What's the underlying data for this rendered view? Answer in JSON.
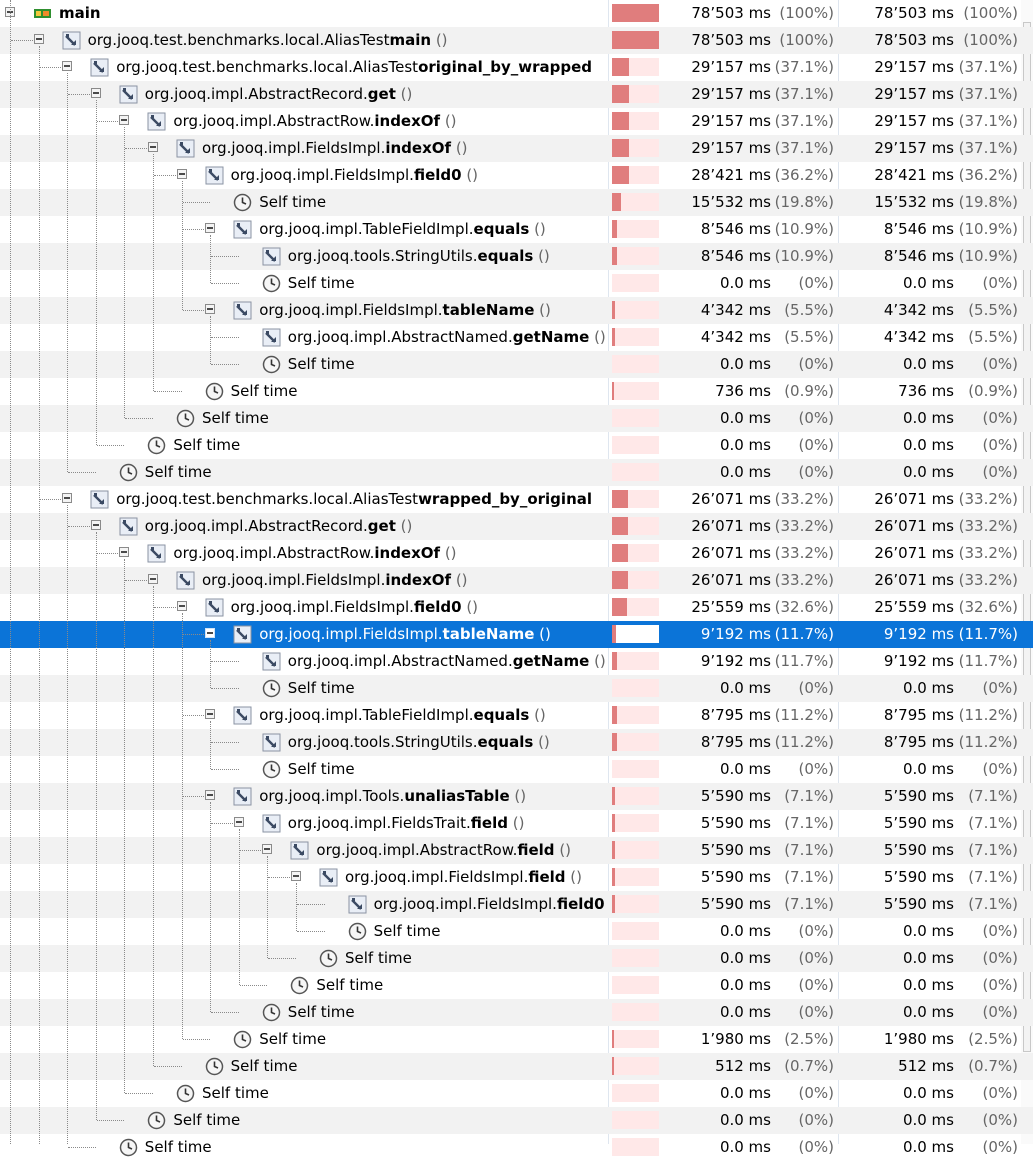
{
  "tree": {
    "rows": [
      {
        "prefix": "",
        "method": "main",
        "paren": "",
        "time1": "78’503 ms",
        "pct1": "(100%)",
        "time2": "78’503 ms",
        "pct2": "(100%)",
        "fraction": 1.0
      },
      {
        "prefix": "org.jooq.test.benchmarks.local.AliasTest",
        "method": "main",
        "paren": " ()",
        "time1": "78’503 ms",
        "pct1": "(100%)",
        "time2": "78’503 ms",
        "pct2": "(100%)",
        "fraction": 1.0
      },
      {
        "prefix": "org.jooq.test.benchmarks.local.AliasTest",
        "method": "original_by_wrapped",
        "paren": "",
        "time1": "29’157 ms",
        "pct1": "(37.1%)",
        "time2": "29’157 ms",
        "pct2": "(37.1%)",
        "fraction": 0.371
      },
      {
        "prefix": "org.jooq.impl.AbstractRecord.",
        "method": "get",
        "paren": " ()",
        "time1": "29’157 ms",
        "pct1": "(37.1%)",
        "time2": "29’157 ms",
        "pct2": "(37.1%)",
        "fraction": 0.371
      },
      {
        "prefix": "org.jooq.impl.AbstractRow.",
        "method": "indexOf",
        "paren": " ()",
        "time1": "29’157 ms",
        "pct1": "(37.1%)",
        "time2": "29’157 ms",
        "pct2": "(37.1%)",
        "fraction": 0.371
      },
      {
        "prefix": "org.jooq.impl.FieldsImpl.",
        "method": "indexOf",
        "paren": " ()",
        "time1": "29’157 ms",
        "pct1": "(37.1%)",
        "time2": "29’157 ms",
        "pct2": "(37.1%)",
        "fraction": 0.371
      },
      {
        "prefix": "org.jooq.impl.FieldsImpl.",
        "method": "field0",
        "paren": " ()",
        "time1": "28’421 ms",
        "pct1": "(36.2%)",
        "time2": "28’421 ms",
        "pct2": "(36.2%)",
        "fraction": 0.362
      },
      {
        "prefix": "Self time",
        "method": "",
        "paren": "",
        "time1": "15’532 ms",
        "pct1": "(19.8%)",
        "time2": "15’532 ms",
        "pct2": "(19.8%)",
        "fraction": 0.198
      },
      {
        "prefix": "org.jooq.impl.TableFieldImpl.",
        "method": "equals",
        "paren": " ()",
        "time1": "8’546 ms",
        "pct1": "(10.9%)",
        "time2": "8’546 ms",
        "pct2": "(10.9%)",
        "fraction": 0.109
      },
      {
        "prefix": "org.jooq.tools.StringUtils.",
        "method": "equals",
        "paren": " ()",
        "time1": "8’546 ms",
        "pct1": "(10.9%)",
        "time2": "8’546 ms",
        "pct2": "(10.9%)",
        "fraction": 0.109
      },
      {
        "prefix": "Self time",
        "method": "",
        "paren": "",
        "time1": "0.0 ms",
        "pct1": "(0%)",
        "time2": "0.0 ms",
        "pct2": "(0%)",
        "fraction": 0
      },
      {
        "prefix": "org.jooq.impl.FieldsImpl.",
        "method": "tableName",
        "paren": " ()",
        "time1": "4’342 ms",
        "pct1": "(5.5%)",
        "time2": "4’342 ms",
        "pct2": "(5.5%)",
        "fraction": 0.055
      },
      {
        "prefix": "org.jooq.impl.AbstractNamed.",
        "method": "getName",
        "paren": " ()",
        "time1": "4’342 ms",
        "pct1": "(5.5%)",
        "time2": "4’342 ms",
        "pct2": "(5.5%)",
        "fraction": 0.055
      },
      {
        "prefix": "Self time",
        "method": "",
        "paren": "",
        "time1": "0.0 ms",
        "pct1": "(0%)",
        "time2": "0.0 ms",
        "pct2": "(0%)",
        "fraction": 0
      },
      {
        "prefix": "Self time",
        "method": "",
        "paren": "",
        "time1": "736 ms",
        "pct1": "(0.9%)",
        "time2": "736 ms",
        "pct2": "(0.9%)",
        "fraction": 0.009
      },
      {
        "prefix": "Self time",
        "method": "",
        "paren": "",
        "time1": "0.0 ms",
        "pct1": "(0%)",
        "time2": "0.0 ms",
        "pct2": "(0%)",
        "fraction": 0
      },
      {
        "prefix": "Self time",
        "method": "",
        "paren": "",
        "time1": "0.0 ms",
        "pct1": "(0%)",
        "time2": "0.0 ms",
        "pct2": "(0%)",
        "fraction": 0
      },
      {
        "prefix": "Self time",
        "method": "",
        "paren": "",
        "time1": "0.0 ms",
        "pct1": "(0%)",
        "time2": "0.0 ms",
        "pct2": "(0%)",
        "fraction": 0
      },
      {
        "prefix": "org.jooq.test.benchmarks.local.AliasTest",
        "method": "wrapped_by_original",
        "paren": "",
        "time1": "26’071 ms",
        "pct1": "(33.2%)",
        "time2": "26’071 ms",
        "pct2": "(33.2%)",
        "fraction": 0.332
      },
      {
        "prefix": "org.jooq.impl.AbstractRecord.",
        "method": "get",
        "paren": " ()",
        "time1": "26’071 ms",
        "pct1": "(33.2%)",
        "time2": "26’071 ms",
        "pct2": "(33.2%)",
        "fraction": 0.332
      },
      {
        "prefix": "org.jooq.impl.AbstractRow.",
        "method": "indexOf",
        "paren": " ()",
        "time1": "26’071 ms",
        "pct1": "(33.2%)",
        "time2": "26’071 ms",
        "pct2": "(33.2%)",
        "fraction": 0.332
      },
      {
        "prefix": "org.jooq.impl.FieldsImpl.",
        "method": "indexOf",
        "paren": " ()",
        "time1": "26’071 ms",
        "pct1": "(33.2%)",
        "time2": "26’071 ms",
        "pct2": "(33.2%)",
        "fraction": 0.332
      },
      {
        "prefix": "org.jooq.impl.FieldsImpl.",
        "method": "field0",
        "paren": " ()",
        "time1": "25’559 ms",
        "pct1": "(32.6%)",
        "time2": "25’559 ms",
        "pct2": "(32.6%)",
        "fraction": 0.326
      },
      {
        "prefix": "org.jooq.impl.FieldsImpl.",
        "method": "tableName",
        "paren": " ()",
        "time1": "9’192 ms",
        "pct1": "(11.7%)",
        "time2": "9’192 ms",
        "pct2": "(11.7%)",
        "fraction": 0.117
      },
      {
        "prefix": "org.jooq.impl.AbstractNamed.",
        "method": "getName",
        "paren": " ()",
        "time1": "9’192 ms",
        "pct1": "(11.7%)",
        "time2": "9’192 ms",
        "pct2": "(11.7%)",
        "fraction": 0.117
      },
      {
        "prefix": "Self time",
        "method": "",
        "paren": "",
        "time1": "0.0 ms",
        "pct1": "(0%)",
        "time2": "0.0 ms",
        "pct2": "(0%)",
        "fraction": 0
      },
      {
        "prefix": "org.jooq.impl.TableFieldImpl.",
        "method": "equals",
        "paren": " ()",
        "time1": "8’795 ms",
        "pct1": "(11.2%)",
        "time2": "8’795 ms",
        "pct2": "(11.2%)",
        "fraction": 0.112
      },
      {
        "prefix": "org.jooq.tools.StringUtils.",
        "method": "equals",
        "paren": " ()",
        "time1": "8’795 ms",
        "pct1": "(11.2%)",
        "time2": "8’795 ms",
        "pct2": "(11.2%)",
        "fraction": 0.112
      },
      {
        "prefix": "Self time",
        "method": "",
        "paren": "",
        "time1": "0.0 ms",
        "pct1": "(0%)",
        "time2": "0.0 ms",
        "pct2": "(0%)",
        "fraction": 0
      },
      {
        "prefix": "org.jooq.impl.Tools.",
        "method": "unaliasTable",
        "paren": " ()",
        "time1": "5’590 ms",
        "pct1": "(7.1%)",
        "time2": "5’590 ms",
        "pct2": "(7.1%)",
        "fraction": 0.071
      },
      {
        "prefix": "org.jooq.impl.FieldsTrait.",
        "method": "field",
        "paren": " ()",
        "time1": "5’590 ms",
        "pct1": "(7.1%)",
        "time2": "5’590 ms",
        "pct2": "(7.1%)",
        "fraction": 0.071
      },
      {
        "prefix": "org.jooq.impl.AbstractRow.",
        "method": "field",
        "paren": " ()",
        "time1": "5’590 ms",
        "pct1": "(7.1%)",
        "time2": "5’590 ms",
        "pct2": "(7.1%)",
        "fraction": 0.071
      },
      {
        "prefix": "org.jooq.impl.FieldsImpl.",
        "method": "field",
        "paren": " ()",
        "time1": "5’590 ms",
        "pct1": "(7.1%)",
        "time2": "5’590 ms",
        "pct2": "(7.1%)",
        "fraction": 0.071
      },
      {
        "prefix": "org.jooq.impl.FieldsImpl.",
        "method": "field0",
        "paren": "",
        "time1": "5’590 ms",
        "pct1": "(7.1%)",
        "time2": "5’590 ms",
        "pct2": "(7.1%)",
        "fraction": 0.071
      },
      {
        "prefix": "Self time",
        "method": "",
        "paren": "",
        "time1": "0.0 ms",
        "pct1": "(0%)",
        "time2": "0.0 ms",
        "pct2": "(0%)",
        "fraction": 0
      },
      {
        "prefix": "Self time",
        "method": "",
        "paren": "",
        "time1": "0.0 ms",
        "pct1": "(0%)",
        "time2": "0.0 ms",
        "pct2": "(0%)",
        "fraction": 0
      },
      {
        "prefix": "Self time",
        "method": "",
        "paren": "",
        "time1": "0.0 ms",
        "pct1": "(0%)",
        "time2": "0.0 ms",
        "pct2": "(0%)",
        "fraction": 0
      },
      {
        "prefix": "Self time",
        "method": "",
        "paren": "",
        "time1": "0.0 ms",
        "pct1": "(0%)",
        "time2": "0.0 ms",
        "pct2": "(0%)",
        "fraction": 0
      },
      {
        "prefix": "Self time",
        "method": "",
        "paren": "",
        "time1": "1’980 ms",
        "pct1": "(2.5%)",
        "time2": "1’980 ms",
        "pct2": "(2.5%)",
        "fraction": 0.025
      },
      {
        "prefix": "Self time",
        "method": "",
        "paren": "",
        "time1": "512 ms",
        "pct1": "(0.7%)",
        "time2": "512 ms",
        "pct2": "(0.7%)",
        "fraction": 0.007
      },
      {
        "prefix": "Self time",
        "method": "",
        "paren": "",
        "time1": "0.0 ms",
        "pct1": "(0%)",
        "time2": "0.0 ms",
        "pct2": "(0%)",
        "fraction": 0
      },
      {
        "prefix": "Self time",
        "method": "",
        "paren": "",
        "time1": "0.0 ms",
        "pct1": "(0%)",
        "time2": "0.0 ms",
        "pct2": "(0%)",
        "fraction": 0
      },
      {
        "prefix": "Self time",
        "method": "",
        "paren": "",
        "time1": "0.0 ms",
        "pct1": "(0%)",
        "time2": "0.0 ms",
        "pct2": "(0%)",
        "fraction": 0
      }
    ]
  },
  "colors": {
    "bar_fill": "#e07d7d",
    "bar_track": "#ffe8e8",
    "selection": "#0b74d8"
  }
}
